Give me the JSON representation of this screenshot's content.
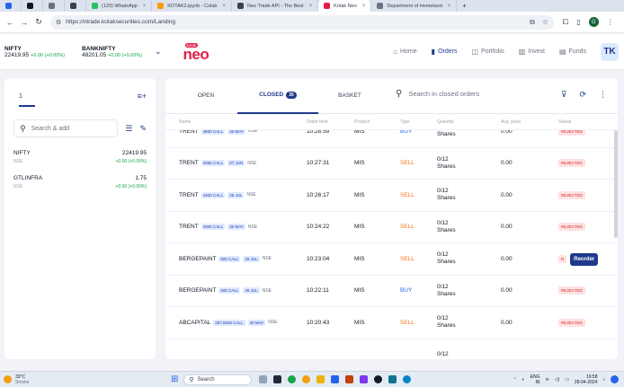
{
  "browser": {
    "tabs": [
      {
        "label": "",
        "color": "#2563eb"
      },
      {
        "label": "",
        "color": "#111827"
      },
      {
        "label": "",
        "color": "#6b7280"
      },
      {
        "label": "",
        "color": "#374151"
      },
      {
        "label": "(120) WhatsApp",
        "color": "#22c55e"
      },
      {
        "label": "KOTAK2.ipynb - Colab",
        "color": "#f59e0b"
      },
      {
        "label": "Neo Trade API - The Best",
        "color": "#374151"
      },
      {
        "label": "Kotak Neo",
        "color": "#e11d48"
      },
      {
        "label": "Department of Homeland",
        "color": "#6b7280"
      }
    ],
    "tab_close": "×",
    "new_tab": "+",
    "url": "https://ntrade.kotaksecurities.com/Landing",
    "profile_initial": "G"
  },
  "header": {
    "tickers": [
      {
        "name": "NIFTY",
        "value": "22419.95",
        "change": "+0.00 (+0.00%)"
      },
      {
        "name": "BANKNIFTY",
        "value": "48201.05",
        "change": "+0.00 (+0.00%)"
      }
    ],
    "logo_small": "kotak",
    "logo_main": "neo",
    "nav": [
      {
        "label": "Home",
        "icon": "home-icon",
        "glyph": "⌂"
      },
      {
        "label": "Orders",
        "icon": "orders-icon",
        "glyph": "▮",
        "active": true
      },
      {
        "label": "Portfolio",
        "icon": "portfolio-icon",
        "glyph": "◫"
      },
      {
        "label": "Invest",
        "icon": "invest-icon",
        "glyph": "▥"
      },
      {
        "label": "Funds",
        "icon": "funds-icon",
        "glyph": "▤"
      }
    ],
    "avatar": "TK"
  },
  "watchlist": {
    "tab": "1",
    "search_placeholder": "Search & add",
    "items": [
      {
        "name": "NIFTY",
        "exchange": "NSE",
        "price": "22419.95",
        "change": "+0.00 (+0.00%)"
      },
      {
        "name": "GTLINFRA",
        "exchange": "NSE",
        "price": "1.75",
        "change": "+0.00 (+0.00%)"
      }
    ]
  },
  "orders": {
    "tabs": {
      "open": "OPEN",
      "closed": "CLOSED",
      "closed_count": "35",
      "basket": "BASKET"
    },
    "search_placeholder": "Search in closed orders",
    "columns": {
      "name": "Name",
      "time": "Order time",
      "product": "Product",
      "type": "Type",
      "qty": "Quantity",
      "price": "Avg. price",
      "status": "Status"
    },
    "rows": [
      {
        "symbol": "TRENT",
        "tag1": "4600 CALL",
        "tag2": "30 MAY",
        "exch": "NSE",
        "time": "10:28:59",
        "product": "MIS",
        "type": "BUY",
        "qty1": "",
        "qty2": "Shares",
        "price": "0.00",
        "status": "REJECTED"
      },
      {
        "symbol": "TRENT",
        "tag1": "4050 CALL",
        "tag2": "27 JUN",
        "exch": "NSE",
        "time": "10:27:31",
        "product": "MIS",
        "type": "SELL",
        "qty1": "0/12",
        "qty2": "Shares",
        "price": "0.00",
        "status": "REJECTED"
      },
      {
        "symbol": "TRENT",
        "tag1": "4400 CALL",
        "tag2": "25 JUL",
        "exch": "NSE",
        "time": "10:26:17",
        "product": "MIS",
        "type": "SELL",
        "qty1": "0/12",
        "qty2": "Shares",
        "price": "0.00",
        "status": "REJECTED"
      },
      {
        "symbol": "TRENT",
        "tag1": "4300 CALL",
        "tag2": "30 MAY",
        "exch": "NSE",
        "time": "10:24:22",
        "product": "MIS",
        "type": "SELL",
        "qty1": "0/12",
        "qty2": "Shares",
        "price": "0.00",
        "status": "REJECTED"
      },
      {
        "symbol": "BERGEPAINT",
        "tag1": "500 CALL",
        "tag2": "25 JUL",
        "exch": "NSE",
        "time": "10:23:04",
        "product": "MIS",
        "type": "SELL",
        "qty1": "0/12",
        "qty2": "Shares",
        "price": "0.00",
        "status": "R",
        "reorder": "Reorder"
      },
      {
        "symbol": "BERGEPAINT",
        "tag1": "500 CALL",
        "tag2": "25 JUL",
        "exch": "NSE",
        "time": "10:22:11",
        "product": "MIS",
        "type": "BUY",
        "qty1": "0/12",
        "qty2": "Shares",
        "price": "0.00",
        "status": "REJECTED"
      },
      {
        "symbol": "ABCAPITAL",
        "tag1": "257.5000 CALL",
        "tag2": "30 MAY",
        "exch": "NSE",
        "time": "10:20:43",
        "product": "MIS",
        "type": "SELL",
        "qty1": "0/12",
        "qty2": "Shares",
        "price": "0.00",
        "status": "REJECTED"
      },
      {
        "symbol": "",
        "tag1": "",
        "tag2": "",
        "exch": "",
        "time": "",
        "product": "",
        "type": "",
        "qty1": "0/12",
        "qty2": "",
        "price": "",
        "status": ""
      }
    ]
  },
  "taskbar": {
    "temp": "33°C",
    "weather": "Smoke",
    "search": "Search",
    "lang1": "ENG",
    "lang2": "IN",
    "time": "19:58",
    "date": "28-04-2024"
  },
  "colors": {
    "accent": "#1e3a8a",
    "brand": "#e11d48",
    "sell": "#f97316",
    "buy": "#2563eb",
    "rejected": "#dc2626"
  }
}
